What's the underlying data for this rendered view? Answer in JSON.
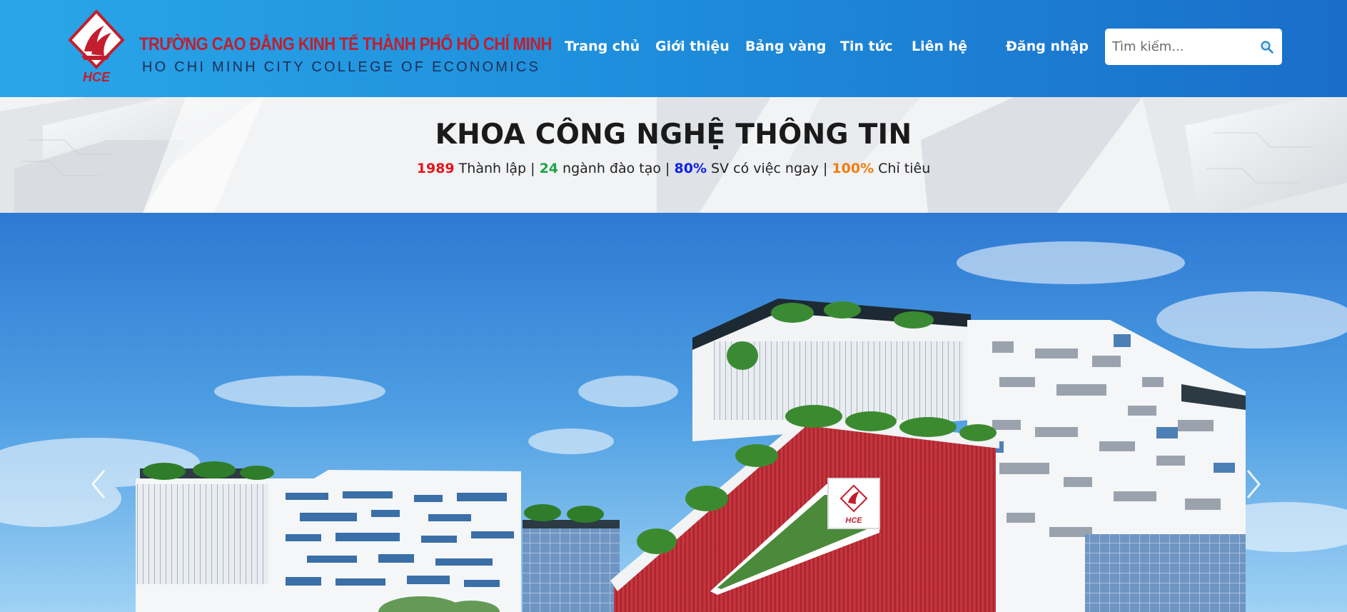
{
  "header": {
    "logo": {
      "text": "HCE",
      "school_name_vi": "TRƯỜNG CAO ĐẲNG KINH TẾ THÀNH PHỐ HỒ CHÍ MINH",
      "school_name_en": "HO CHI MINH CITY COLLEGE OF ECONOMICS"
    },
    "nav": [
      {
        "label": "Trang chủ"
      },
      {
        "label": "Giới thiệu"
      },
      {
        "label": "Bảng vàng"
      },
      {
        "label": "Tin tức"
      },
      {
        "label": "Liên hệ"
      }
    ],
    "login_label": "Đăng nhập",
    "search": {
      "placeholder": "Tìm kiếm...",
      "value": "",
      "icon": "search-icon"
    }
  },
  "banner": {
    "title": "KHOA CÔNG NGHỆ THÔNG TIN",
    "stats": [
      {
        "value": "1989",
        "label": " Thành lập",
        "color": "#e3161b"
      },
      {
        "value": "24",
        "label": " ngành đào tạo",
        "color": "#1fa34a"
      },
      {
        "value": "80%",
        "label": " SV có việc ngay",
        "color": "#1020e6"
      },
      {
        "value": "100%",
        "label": " Chỉ tiêu",
        "color": "#ee7d10"
      }
    ],
    "separator": " | "
  },
  "carousel": {
    "prev_icon": "chevron-left-icon",
    "next_icon": "chevron-right-icon"
  },
  "colors": {
    "header_start": "#2aa6e8",
    "header_end": "#1a6ec9",
    "brand_red": "#c21e2e",
    "building_red": "#c8343d"
  }
}
